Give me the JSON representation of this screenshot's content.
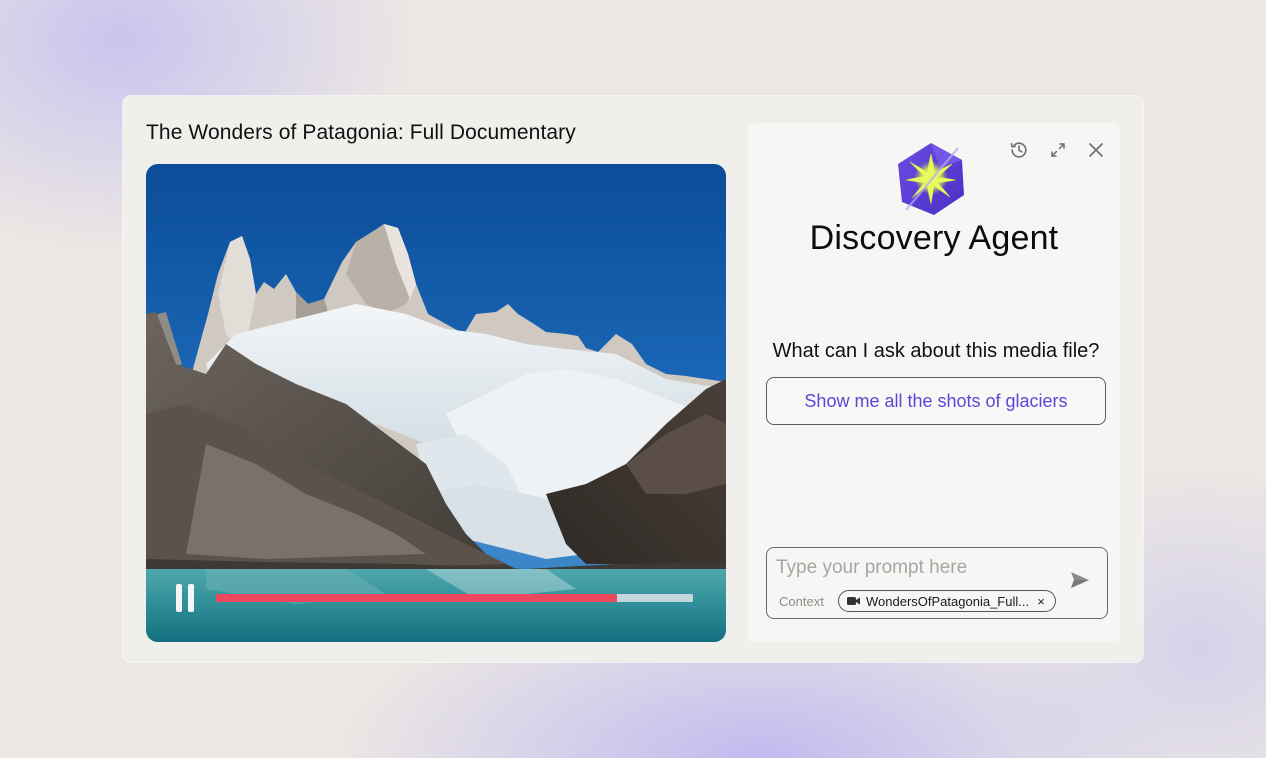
{
  "video": {
    "title": "The Wonders of Patagonia: Full Documentary",
    "playback_state": "playing",
    "progress_percent": 84,
    "icons": {
      "pause": "pause-icon"
    }
  },
  "agent": {
    "name": "Discovery Agent",
    "logo": "sparkle-hexagon-logo",
    "header_icons": [
      "history-icon",
      "expand-icon",
      "close-icon"
    ],
    "suggestion_heading": "What can I ask about this media file?",
    "suggestions": [
      "Show me all the shots of glaciers"
    ],
    "prompt": {
      "placeholder": "Type your prompt here",
      "value": "",
      "context_label": "Context",
      "context_file": "WondersOfPatagonia_Full...",
      "send_icon": "send-icon"
    }
  },
  "colors": {
    "accent": "#5a47d6",
    "progress": "#ee4760",
    "logo_purple": "#5b3fd6",
    "logo_star": "#e6f85a"
  }
}
